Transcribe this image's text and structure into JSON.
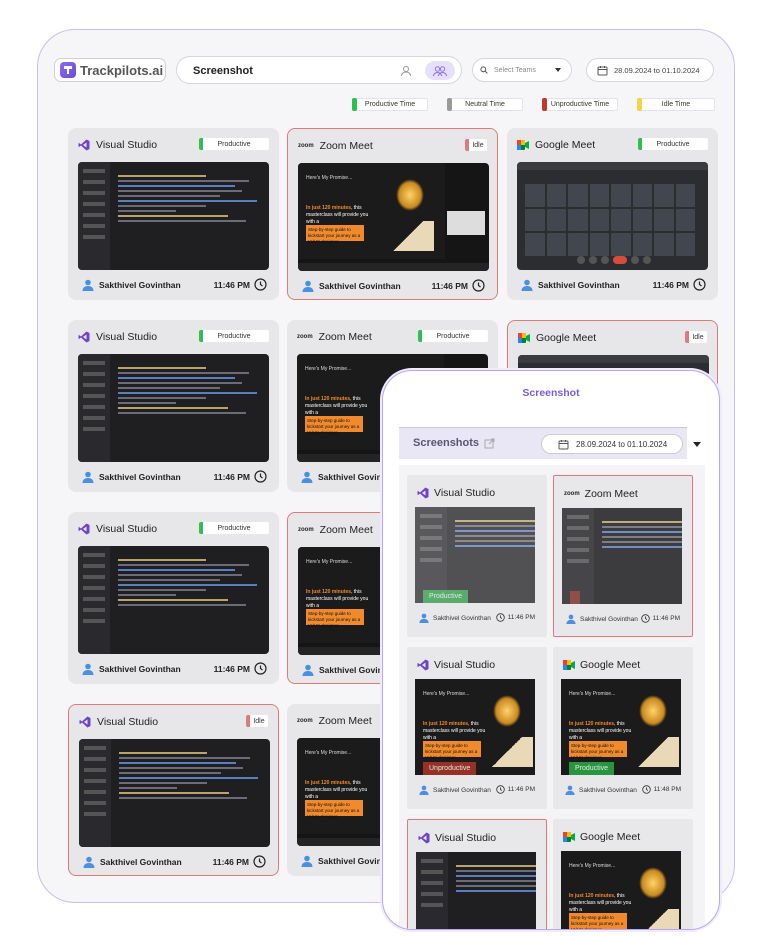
{
  "header": {
    "brand": "Trackpilots.ai",
    "section_title": "Screenshot",
    "teams_placeholder": "Select Teams",
    "date_range": "28.09.2024 to 01.10.2024"
  },
  "legend": [
    {
      "label": "Productive Time",
      "color": "#2fbf4f"
    },
    {
      "label": "Neutral Time",
      "color": "#9a9a9a"
    },
    {
      "label": "Unproductive Time",
      "color": "#c0392b"
    },
    {
      "label": "Idle Time",
      "color": "#f2d447"
    }
  ],
  "cards": [
    {
      "app": "Visual Studio",
      "status": "Productive",
      "user": "Sakthivel Govinthan",
      "time": "11:46 PM"
    },
    {
      "app": "Zoom Meet",
      "status": "Idle",
      "user": "Sakthivel Govinthan",
      "time": "11:46 PM"
    },
    {
      "app": "Google Meet",
      "status": "Productive",
      "user": "Sakthivel Govinthan",
      "time": "11:46 PM"
    },
    {
      "app": "Visual Studio",
      "status": "Productive",
      "user": "Sakthivel Govinthan",
      "time": "11:46 PM"
    },
    {
      "app": "Zoom Meet",
      "status": "Productive",
      "user": "Sakthivel Govinthan",
      "time": ""
    },
    {
      "app": "Google Meet",
      "status": "Idle",
      "user": "",
      "time": ""
    },
    {
      "app": "Visual Studio",
      "status": "Productive",
      "user": "Sakthivel Govinthan",
      "time": "11:46 PM"
    },
    {
      "app": "Zoom Meet",
      "status": "",
      "user": "Sakthivel Govin",
      "time": ""
    },
    {
      "app": "Visual Studio",
      "status": "Idle",
      "user": "Sakthivel Govinthan",
      "time": "11:46 PM"
    },
    {
      "app": "Zoom Meet",
      "status": "",
      "user": "Sakthivel Govin",
      "time": ""
    }
  ],
  "mobile": {
    "title": "Screenshot",
    "heading": "Screenshots",
    "date_range": "28.09.2024 to 01.10.2024",
    "cards": [
      {
        "app": "Visual Studio",
        "status": "Productive",
        "user": "Sakthivel Govinthan",
        "time": "11:46 PM"
      },
      {
        "app": "Zoom Meet",
        "status": "",
        "user": "Sakthivel Govinthan",
        "time": "11:46 PM"
      },
      {
        "app": "Visual Studio",
        "status": "Unproductive",
        "user": "Sakthivel Govinthan",
        "time": "11:46 PM"
      },
      {
        "app": "Google Meet",
        "status": "Productive",
        "user": "Sakthivel Govinthan",
        "time": "11:48 PM"
      },
      {
        "app": "Visual Studio",
        "status": "",
        "user": "",
        "time": ""
      },
      {
        "app": "Google Meet",
        "status": "",
        "user": "",
        "time": ""
      }
    ]
  },
  "zoom_slide": {
    "intro": "Here's My Promise...",
    "highlight": "In just 120 minutes,",
    "rest": "this masterclass will provide you with a",
    "cta": "Step-by-step guide to kickstart your journey as a UI/UX designer."
  }
}
